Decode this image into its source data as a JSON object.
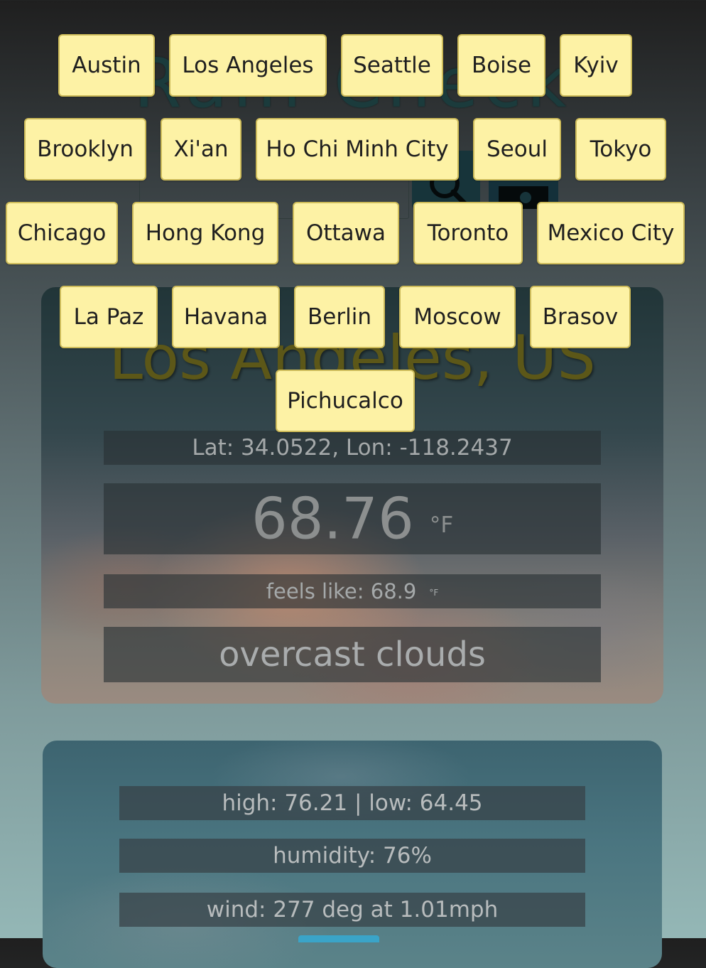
{
  "header": {
    "app_title": "Rain Check",
    "search_value": ""
  },
  "cities": [
    "Austin",
    "Los Angeles",
    "Seattle",
    "Boise",
    "Kyiv",
    "Brooklyn",
    "Xi'an",
    "Ho Chi Minh City",
    "Seoul",
    "Tokyo",
    "Chicago",
    "Hong Kong",
    "Ottawa",
    "Toronto",
    "Mexico City",
    "La Paz",
    "Havana",
    "Berlin",
    "Moscow",
    "Brasov",
    "Pichucalco"
  ],
  "weather": {
    "location": "Los Angeles, US",
    "coords": "Lat: 34.0522, Lon: -118.2437",
    "temperature": "68.76",
    "temp_unit": "°F",
    "feels_like": "feels like: 68.9",
    "feels_unit": "°F",
    "condition": "overcast clouds"
  },
  "details": {
    "high_low": "high: 76.21 | low: 64.45",
    "humidity": "humidity: 76%",
    "wind": "wind: 277 deg at 1.01mph"
  },
  "colors": {
    "city_button_bg": "#fdf2a5",
    "city_button_border": "#cdbb5a",
    "title_color": "#1b3b3c",
    "location_color": "#5c5718",
    "accent": "#3aa4c8"
  },
  "icons": {
    "search": "search-icon",
    "locate": "location-icon"
  }
}
